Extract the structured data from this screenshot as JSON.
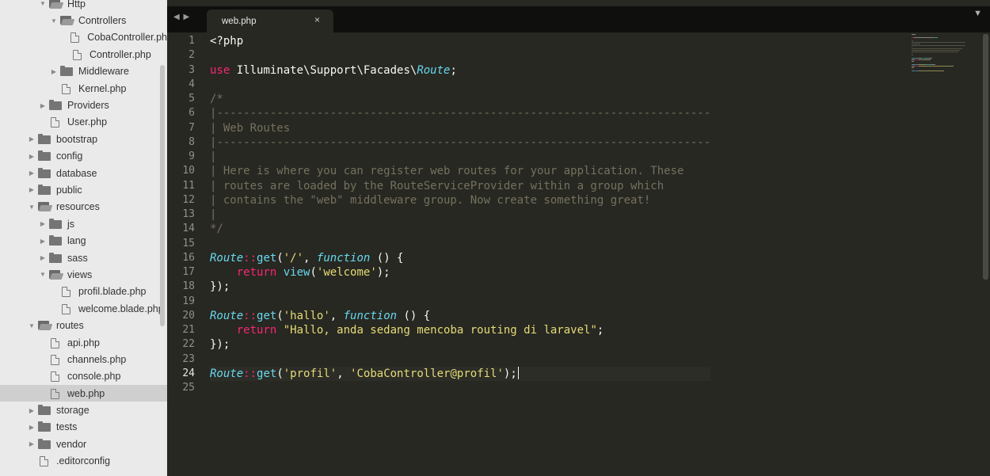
{
  "sidebar": {
    "items": [
      {
        "label": "Http",
        "type": "folder",
        "expanded": true,
        "depth": 1
      },
      {
        "label": "Controllers",
        "type": "folder",
        "expanded": true,
        "depth": 2
      },
      {
        "label": "CobaController.ph",
        "type": "file",
        "depth": 3
      },
      {
        "label": "Controller.php",
        "type": "file",
        "depth": 3
      },
      {
        "label": "Middleware",
        "type": "folder",
        "expanded": false,
        "depth": 2
      },
      {
        "label": "Kernel.php",
        "type": "file",
        "depth": 2
      },
      {
        "label": "Providers",
        "type": "folder",
        "expanded": false,
        "depth": 1
      },
      {
        "label": "User.php",
        "type": "file",
        "depth": 1
      },
      {
        "label": "bootstrap",
        "type": "folder",
        "expanded": false,
        "depth": 0
      },
      {
        "label": "config",
        "type": "folder",
        "expanded": false,
        "depth": 0
      },
      {
        "label": "database",
        "type": "folder",
        "expanded": false,
        "depth": 0
      },
      {
        "label": "public",
        "type": "folder",
        "expanded": false,
        "depth": 0
      },
      {
        "label": "resources",
        "type": "folder",
        "expanded": true,
        "depth": 0
      },
      {
        "label": "js",
        "type": "folder",
        "expanded": false,
        "depth": 1
      },
      {
        "label": "lang",
        "type": "folder",
        "expanded": false,
        "depth": 1
      },
      {
        "label": "sass",
        "type": "folder",
        "expanded": false,
        "depth": 1
      },
      {
        "label": "views",
        "type": "folder",
        "expanded": true,
        "depth": 1
      },
      {
        "label": "profil.blade.php",
        "type": "file",
        "depth": 2
      },
      {
        "label": "welcome.blade.php",
        "type": "file",
        "depth": 2
      },
      {
        "label": "routes",
        "type": "folder",
        "expanded": true,
        "depth": 0
      },
      {
        "label": "api.php",
        "type": "file",
        "depth": 1
      },
      {
        "label": "channels.php",
        "type": "file",
        "depth": 1
      },
      {
        "label": "console.php",
        "type": "file",
        "depth": 1
      },
      {
        "label": "web.php",
        "type": "file",
        "depth": 1,
        "selected": true
      },
      {
        "label": "storage",
        "type": "folder",
        "expanded": false,
        "depth": 0
      },
      {
        "label": "tests",
        "type": "folder",
        "expanded": false,
        "depth": 0
      },
      {
        "label": "vendor",
        "type": "folder",
        "expanded": false,
        "depth": 0
      },
      {
        "label": ".editorconfig",
        "type": "file",
        "depth": 0
      }
    ]
  },
  "tabbar": {
    "nav_arrows": "◀ ▶",
    "tab_title": "web.php",
    "close_glyph": "×",
    "dropdown_glyph": "▼"
  },
  "editor": {
    "current_line": 24,
    "lines": [
      [
        {
          "t": "<?php",
          "c": "plain"
        }
      ],
      [],
      [
        {
          "t": "use",
          "c": "keyword"
        },
        {
          "t": " Illuminate\\Support\\Facades\\",
          "c": "plain"
        },
        {
          "t": "Route",
          "c": "class"
        },
        {
          "t": ";",
          "c": "plain"
        }
      ],
      [],
      [
        {
          "t": "/*",
          "c": "comment"
        }
      ],
      [
        {
          "t": "|--------------------------------------------------------------------------",
          "c": "comment"
        }
      ],
      [
        {
          "t": "| Web Routes",
          "c": "comment"
        }
      ],
      [
        {
          "t": "|--------------------------------------------------------------------------",
          "c": "comment"
        }
      ],
      [
        {
          "t": "|",
          "c": "comment"
        }
      ],
      [
        {
          "t": "| Here is where you can register web routes for your application. These",
          "c": "comment"
        }
      ],
      [
        {
          "t": "| routes are loaded by the RouteServiceProvider within a group which",
          "c": "comment"
        }
      ],
      [
        {
          "t": "| contains the \"web\" middleware group. Now create something great!",
          "c": "comment"
        }
      ],
      [
        {
          "t": "|",
          "c": "comment"
        }
      ],
      [
        {
          "t": "*/",
          "c": "comment"
        }
      ],
      [],
      [
        {
          "t": "Route",
          "c": "class"
        },
        {
          "t": "::",
          "c": "keyword"
        },
        {
          "t": "get",
          "c": "func"
        },
        {
          "t": "(",
          "c": "plain"
        },
        {
          "t": "'/'",
          "c": "string"
        },
        {
          "t": ", ",
          "c": "plain"
        },
        {
          "t": "function",
          "c": "storage"
        },
        {
          "t": " () {",
          "c": "plain"
        }
      ],
      [
        {
          "t": "    ",
          "c": "plain"
        },
        {
          "t": "return",
          "c": "keyword"
        },
        {
          "t": " ",
          "c": "plain"
        },
        {
          "t": "view",
          "c": "func"
        },
        {
          "t": "(",
          "c": "plain"
        },
        {
          "t": "'welcome'",
          "c": "string"
        },
        {
          "t": ");",
          "c": "plain"
        }
      ],
      [
        {
          "t": "});",
          "c": "plain"
        }
      ],
      [],
      [
        {
          "t": "Route",
          "c": "class"
        },
        {
          "t": "::",
          "c": "keyword"
        },
        {
          "t": "get",
          "c": "func"
        },
        {
          "t": "(",
          "c": "plain"
        },
        {
          "t": "'hallo'",
          "c": "string"
        },
        {
          "t": ", ",
          "c": "plain"
        },
        {
          "t": "function",
          "c": "storage"
        },
        {
          "t": " () {",
          "c": "plain"
        }
      ],
      [
        {
          "t": "    ",
          "c": "plain"
        },
        {
          "t": "return",
          "c": "keyword"
        },
        {
          "t": " ",
          "c": "plain"
        },
        {
          "t": "\"Hallo, anda sedang mencoba routing di laravel\"",
          "c": "string"
        },
        {
          "t": ";",
          "c": "plain"
        }
      ],
      [
        {
          "t": "});",
          "c": "plain"
        }
      ],
      [],
      [
        {
          "t": "Route",
          "c": "class"
        },
        {
          "t": "::",
          "c": "keyword"
        },
        {
          "t": "get",
          "c": "func"
        },
        {
          "t": "(",
          "c": "plain"
        },
        {
          "t": "'profil'",
          "c": "string"
        },
        {
          "t": ", ",
          "c": "plain"
        },
        {
          "t": "'CobaController@profil'",
          "c": "string"
        },
        {
          "t": ");",
          "c": "plain"
        }
      ],
      []
    ]
  },
  "colors": {
    "background": "#272822",
    "sidebar": "#eaeaea",
    "keyword": "#f92672",
    "string": "#e6db74",
    "class": "#66d9ef",
    "comment": "#75715e"
  }
}
